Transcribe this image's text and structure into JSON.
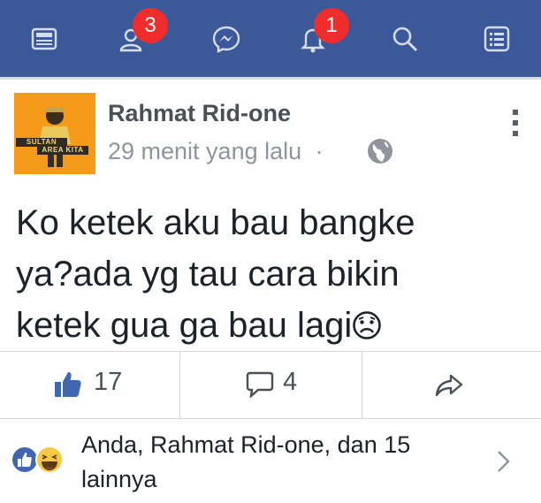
{
  "colors": {
    "topbar": "#3b5998",
    "badge": "#f02d2d",
    "like_blue": "#4267b2",
    "muted_text": "#90949c"
  },
  "nav": {
    "items": [
      {
        "name": "news-feed-icon"
      },
      {
        "name": "friend-requests-icon",
        "badge": "3"
      },
      {
        "name": "messenger-icon"
      },
      {
        "name": "notifications-icon",
        "badge": "1"
      },
      {
        "name": "search-icon"
      },
      {
        "name": "more-menu-icon"
      }
    ]
  },
  "post": {
    "author": "Rahmat Rid-one",
    "time": "29 menit yang lalu",
    "separator": "·",
    "privacy_icon": "globe-icon",
    "avatar_banner_1": "SULTAN",
    "avatar_banner_2": "AREA KITA",
    "text_line_1": "Ko ketek aku bau bangke",
    "text_line_2": "ya?ada yg tau cara bikin",
    "text_line_3": "ketek gua ga bau lagi",
    "text_emoji": "sad-face-icon"
  },
  "actions": {
    "like_count": "17",
    "comment_count": "4",
    "share_icon": "share-icon"
  },
  "reactions": {
    "text": "Anda, Rahmat Rid-one, dan 15 lainnya",
    "icons": [
      "like-reaction-icon",
      "haha-reaction-icon"
    ]
  }
}
